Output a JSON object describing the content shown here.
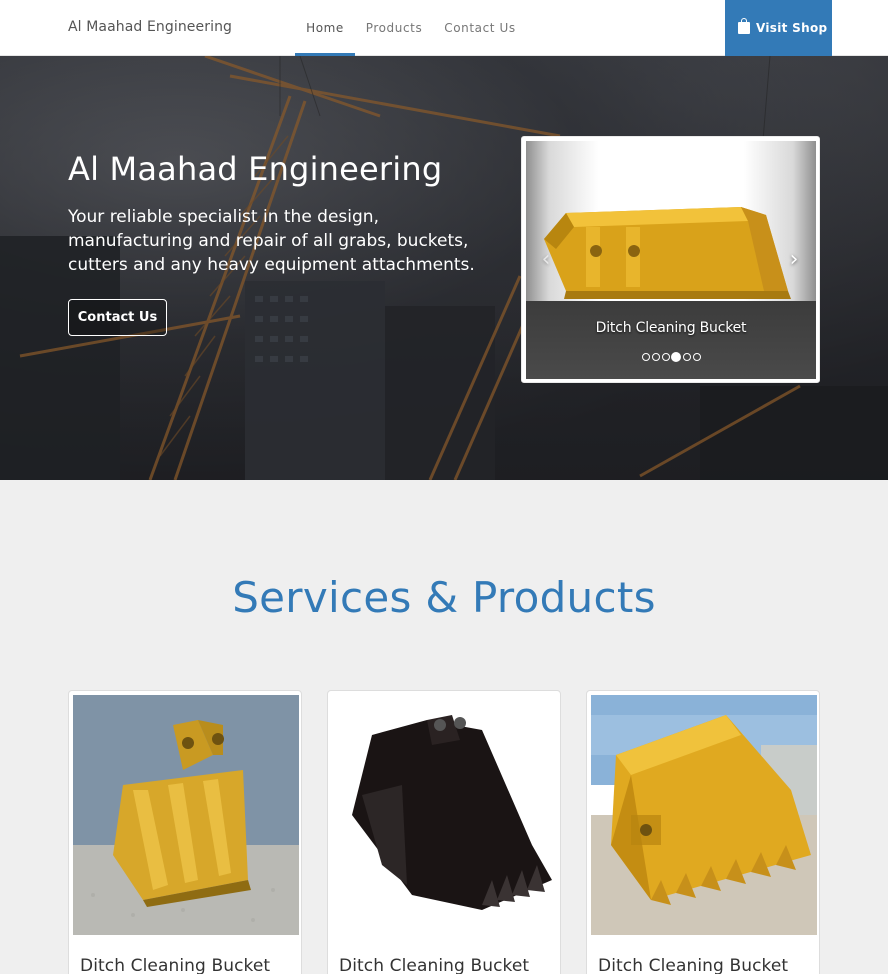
{
  "nav": {
    "brand": "Al Maahad Engineering",
    "items": [
      {
        "label": "Home",
        "active": true
      },
      {
        "label": "Products",
        "active": false
      },
      {
        "label": "Contact Us",
        "active": false
      }
    ],
    "shop_button": {
      "label": "Visit Shop",
      "icon": "shopping-bag-icon"
    }
  },
  "hero": {
    "title": "Al Maahad Engineering",
    "subtitle": "Your reliable specialist in the design, manufacturing and repair of all grabs, buckets, cutters and any heavy equipment attachments.",
    "cta_label": "Contact Us"
  },
  "carousel": {
    "caption": "Ditch Cleaning Bucket",
    "slide_count": 6,
    "active_index": 3,
    "prev_icon": "chevron-left-icon",
    "next_icon": "chevron-right-icon"
  },
  "section": {
    "title": "Services & Products",
    "cards": [
      {
        "title": "Ditch Cleaning Bucket"
      },
      {
        "title": "Ditch Cleaning Bucket"
      },
      {
        "title": "Ditch Cleaning Bucket"
      }
    ]
  },
  "colors": {
    "accent": "#337ab7",
    "page_background": "#efefef",
    "bucket_yellow": "#e6b422"
  }
}
